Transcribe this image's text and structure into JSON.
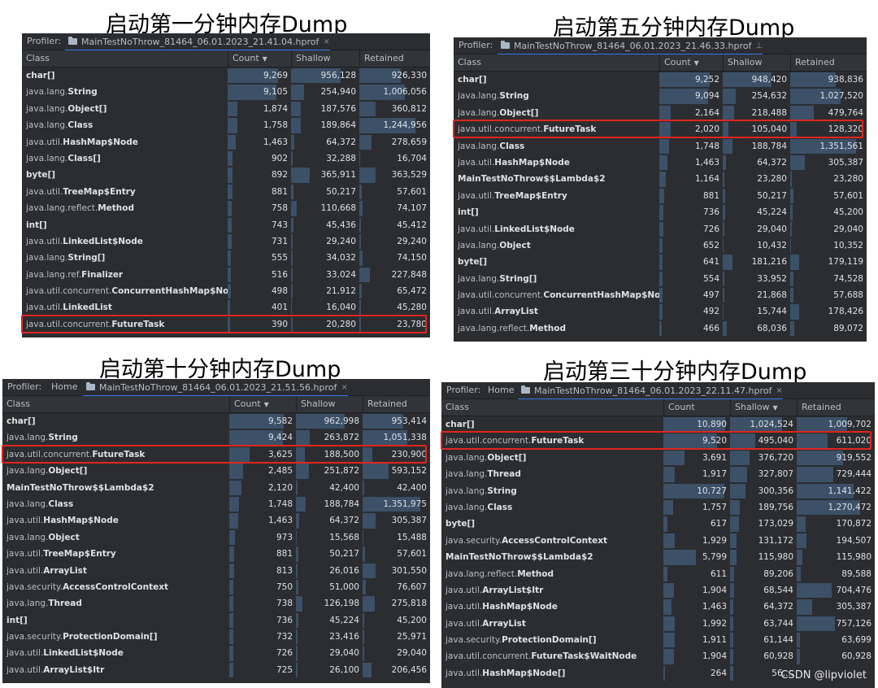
{
  "panels": [
    {
      "caption": "启动第一分钟内存Dump",
      "profiler_label": "Profiler:",
      "home_label": "",
      "tab_title": "MainTestNoThrow_81464_06.01.2023_21.41.04.hprof",
      "tab_close": "×",
      "columns": {
        "class": "Class",
        "count": "Count",
        "shallow": "Shallow",
        "retained": "Retained"
      },
      "sort_column": "count",
      "highlight_index": 15,
      "rows": [
        {
          "pre": "",
          "bold": "char[]",
          "count": "9,269",
          "shallow": "956,128",
          "retained": "926,330",
          "cf": 0.86,
          "sf": 0.78,
          "rf": 0.63
        },
        {
          "pre": "java.lang.",
          "bold": "String",
          "count": "9,105",
          "shallow": "254,940",
          "retained": "1,006,056",
          "cf": 0.84,
          "sf": 0.21,
          "rf": 0.69
        },
        {
          "pre": "java.lang.",
          "bold": "Object[]",
          "count": "1,874",
          "shallow": "187,576",
          "retained": "360,812",
          "cf": 0.17,
          "sf": 0.15,
          "rf": 0.25
        },
        {
          "pre": "java.lang.",
          "bold": "Class",
          "count": "1,758",
          "shallow": "189,864",
          "retained": "1,244,956",
          "cf": 0.16,
          "sf": 0.16,
          "rf": 0.85
        },
        {
          "pre": "java.util.",
          "bold": "HashMap$Node",
          "count": "1,463",
          "shallow": "64,372",
          "retained": "278,659",
          "cf": 0.14,
          "sf": 0.05,
          "rf": 0.19
        },
        {
          "pre": "java.lang.",
          "bold": "Class[]",
          "count": "902",
          "shallow": "32,288",
          "retained": "16,704",
          "cf": 0.08,
          "sf": 0.03,
          "rf": 0.01
        },
        {
          "pre": "",
          "bold": "byte[]",
          "count": "892",
          "shallow": "365,911",
          "retained": "363,529",
          "cf": 0.08,
          "sf": 0.3,
          "rf": 0.25
        },
        {
          "pre": "java.util.",
          "bold": "TreeMap$Entry",
          "count": "881",
          "shallow": "50,217",
          "retained": "57,601",
          "cf": 0.08,
          "sf": 0.04,
          "rf": 0.04
        },
        {
          "pre": "java.lang.reflect.",
          "bold": "Method",
          "count": "758",
          "shallow": "110,668",
          "retained": "74,107",
          "cf": 0.07,
          "sf": 0.09,
          "rf": 0.05
        },
        {
          "pre": "",
          "bold": "int[]",
          "count": "743",
          "shallow": "45,436",
          "retained": "45,412",
          "cf": 0.07,
          "sf": 0.04,
          "rf": 0.03
        },
        {
          "pre": "java.util.",
          "bold": "LinkedList$Node",
          "count": "731",
          "shallow": "29,240",
          "retained": "29,240",
          "cf": 0.07,
          "sf": 0.02,
          "rf": 0.02
        },
        {
          "pre": "java.lang.",
          "bold": "String[]",
          "count": "555",
          "shallow": "34,032",
          "retained": "74,150",
          "cf": 0.05,
          "sf": 0.03,
          "rf": 0.05
        },
        {
          "pre": "java.lang.ref.",
          "bold": "Finalizer",
          "count": "516",
          "shallow": "33,024",
          "retained": "227,848",
          "cf": 0.05,
          "sf": 0.03,
          "rf": 0.16
        },
        {
          "pre": "java.util.concurrent.",
          "bold": "ConcurrentHashMap$Node",
          "count": "498",
          "shallow": "21,912",
          "retained": "65,472",
          "cf": 0.05,
          "sf": 0.02,
          "rf": 0.04
        },
        {
          "pre": "java.util.",
          "bold": "LinkedList",
          "count": "401",
          "shallow": "16,040",
          "retained": "45,280",
          "cf": 0.04,
          "sf": 0.01,
          "rf": 0.03
        },
        {
          "pre": "java.util.concurrent.",
          "bold": "FutureTask",
          "count": "390",
          "shallow": "20,280",
          "retained": "23,780",
          "cf": 0.04,
          "sf": 0.02,
          "rf": 0.02
        }
      ]
    },
    {
      "caption": "启动第五分钟内存Dump",
      "profiler_label": "Profiler:",
      "home_label": "",
      "tab_title": "MainTestNoThrow_81464_06.01.2023_21.46.33.hprof",
      "tab_close": "",
      "columns": {
        "class": "Class",
        "count": "Count",
        "shallow": "Shallow",
        "retained": "Retained"
      },
      "sort_column": "count",
      "highlight_index": 3,
      "rows": [
        {
          "pre": "",
          "bold": "char[]",
          "count": "9,252",
          "shallow": "948,420",
          "retained": "938,836",
          "cf": 0.86,
          "sf": 0.78,
          "rf": 0.64
        },
        {
          "pre": "java.lang.",
          "bold": "String",
          "count": "9,094",
          "shallow": "254,632",
          "retained": "1,027,520",
          "cf": 0.84,
          "sf": 0.21,
          "rf": 0.7
        },
        {
          "pre": "java.lang.",
          "bold": "Object[]",
          "count": "2,164",
          "shallow": "218,488",
          "retained": "479,764",
          "cf": 0.2,
          "sf": 0.18,
          "rf": 0.33
        },
        {
          "pre": "java.util.concurrent.",
          "bold": "FutureTask",
          "count": "2,020",
          "shallow": "105,040",
          "retained": "128,320",
          "cf": 0.19,
          "sf": 0.09,
          "rf": 0.09
        },
        {
          "pre": "java.lang.",
          "bold": "Class",
          "count": "1,748",
          "shallow": "188,784",
          "retained": "1,351,561",
          "cf": 0.16,
          "sf": 0.16,
          "rf": 0.92
        },
        {
          "pre": "java.util.",
          "bold": "HashMap$Node",
          "count": "1,463",
          "shallow": "64,372",
          "retained": "305,387",
          "cf": 0.14,
          "sf": 0.05,
          "rf": 0.21
        },
        {
          "pre": "",
          "bold": "MainTestNoThrow$$Lambda$2",
          "count": "1,164",
          "shallow": "23,280",
          "retained": "23,280",
          "cf": 0.11,
          "sf": 0.02,
          "rf": 0.02
        },
        {
          "pre": "java.util.",
          "bold": "TreeMap$Entry",
          "count": "881",
          "shallow": "50,217",
          "retained": "57,601",
          "cf": 0.08,
          "sf": 0.04,
          "rf": 0.04
        },
        {
          "pre": "",
          "bold": "int[]",
          "count": "736",
          "shallow": "45,224",
          "retained": "45,200",
          "cf": 0.07,
          "sf": 0.04,
          "rf": 0.03
        },
        {
          "pre": "java.util.",
          "bold": "LinkedList$Node",
          "count": "726",
          "shallow": "29,040",
          "retained": "29,040",
          "cf": 0.07,
          "sf": 0.02,
          "rf": 0.02
        },
        {
          "pre": "java.lang.",
          "bold": "Object",
          "count": "652",
          "shallow": "10,432",
          "retained": "10,352",
          "cf": 0.06,
          "sf": 0.01,
          "rf": 0.01
        },
        {
          "pre": "",
          "bold": "byte[]",
          "count": "641",
          "shallow": "181,216",
          "retained": "179,119",
          "cf": 0.06,
          "sf": 0.15,
          "rf": 0.12
        },
        {
          "pre": "java.lang.",
          "bold": "String[]",
          "count": "554",
          "shallow": "33,952",
          "retained": "74,528",
          "cf": 0.05,
          "sf": 0.03,
          "rf": 0.05
        },
        {
          "pre": "java.util.concurrent.",
          "bold": "ConcurrentHashMap$Node",
          "count": "497",
          "shallow": "21,868",
          "retained": "57,688",
          "cf": 0.05,
          "sf": 0.02,
          "rf": 0.04
        },
        {
          "pre": "java.util.",
          "bold": "ArrayList",
          "count": "492",
          "shallow": "15,744",
          "retained": "178,426",
          "cf": 0.05,
          "sf": 0.01,
          "rf": 0.12
        },
        {
          "pre": "java.lang.reflect.",
          "bold": "Method",
          "count": "466",
          "shallow": "68,036",
          "retained": "89,072",
          "cf": 0.04,
          "sf": 0.06,
          "rf": 0.06
        }
      ]
    },
    {
      "caption": "启动第十分钟内存Dump",
      "profiler_label": "Profiler:",
      "home_label": "Home",
      "tab_title": "MainTestNoThrow_81464_06.01.2023_21.51.56.hprof",
      "tab_close": "×",
      "columns": {
        "class": "Class",
        "count": "Count",
        "shallow": "Shallow",
        "retained": "Retained"
      },
      "sort_column": "count",
      "highlight_index": 2,
      "rows": [
        {
          "pre": "",
          "bold": "char[]",
          "count": "9,582",
          "shallow": "962,998",
          "retained": "953,414",
          "cf": 0.88,
          "sf": 0.79,
          "rf": 0.65
        },
        {
          "pre": "java.lang.",
          "bold": "String",
          "count": "9,424",
          "shallow": "263,872",
          "retained": "1,051,338",
          "cf": 0.87,
          "sf": 0.22,
          "rf": 0.72
        },
        {
          "pre": "java.util.concurrent.",
          "bold": "FutureTask",
          "count": "3,625",
          "shallow": "188,500",
          "retained": "230,900",
          "cf": 0.33,
          "sf": 0.15,
          "rf": 0.16
        },
        {
          "pre": "java.lang.",
          "bold": "Object[]",
          "count": "2,485",
          "shallow": "251,872",
          "retained": "593,152",
          "cf": 0.23,
          "sf": 0.21,
          "rf": 0.41
        },
        {
          "pre": "",
          "bold": "MainTestNoThrow$$Lambda$2",
          "count": "2,120",
          "shallow": "42,400",
          "retained": "42,400",
          "cf": 0.2,
          "sf": 0.03,
          "rf": 0.03
        },
        {
          "pre": "java.lang.",
          "bold": "Class",
          "count": "1,748",
          "shallow": "188,784",
          "retained": "1,351,975",
          "cf": 0.16,
          "sf": 0.16,
          "rf": 0.92
        },
        {
          "pre": "java.util.",
          "bold": "HashMap$Node",
          "count": "1,463",
          "shallow": "64,372",
          "retained": "305,387",
          "cf": 0.14,
          "sf": 0.05,
          "rf": 0.21
        },
        {
          "pre": "java.lang.",
          "bold": "Object",
          "count": "973",
          "shallow": "15,568",
          "retained": "15,488",
          "cf": 0.09,
          "sf": 0.01,
          "rf": 0.01
        },
        {
          "pre": "java.util.",
          "bold": "TreeMap$Entry",
          "count": "881",
          "shallow": "50,217",
          "retained": "57,601",
          "cf": 0.08,
          "sf": 0.04,
          "rf": 0.04
        },
        {
          "pre": "java.util.",
          "bold": "ArrayList",
          "count": "813",
          "shallow": "26,016",
          "retained": "301,550",
          "cf": 0.08,
          "sf": 0.02,
          "rf": 0.21
        },
        {
          "pre": "java.security.",
          "bold": "AccessControlContext",
          "count": "750",
          "shallow": "51,000",
          "retained": "76,607",
          "cf": 0.07,
          "sf": 0.04,
          "rf": 0.05
        },
        {
          "pre": "java.lang.",
          "bold": "Thread",
          "count": "738",
          "shallow": "126,198",
          "retained": "275,818",
          "cf": 0.07,
          "sf": 0.1,
          "rf": 0.19
        },
        {
          "pre": "",
          "bold": "int[]",
          "count": "736",
          "shallow": "45,224",
          "retained": "45,200",
          "cf": 0.07,
          "sf": 0.04,
          "rf": 0.03
        },
        {
          "pre": "java.security.",
          "bold": "ProtectionDomain[]",
          "count": "732",
          "shallow": "23,416",
          "retained": "25,971",
          "cf": 0.07,
          "sf": 0.02,
          "rf": 0.02
        },
        {
          "pre": "java.util.",
          "bold": "LinkedList$Node",
          "count": "726",
          "shallow": "29,040",
          "retained": "29,040",
          "cf": 0.07,
          "sf": 0.02,
          "rf": 0.02
        },
        {
          "pre": "java.util.",
          "bold": "ArrayList$Itr",
          "count": "725",
          "shallow": "26,100",
          "retained": "206,456",
          "cf": 0.07,
          "sf": 0.02,
          "rf": 0.14
        }
      ]
    },
    {
      "caption": "启动第三十分钟内存Dump",
      "profiler_label": "Profiler:",
      "home_label": "Home",
      "tab_title": "MainTestNoThrow_81464_06.01.2023_22.11.47.hprof",
      "tab_close": "×",
      "columns": {
        "class": "Class",
        "count": "Count",
        "shallow": "Shallow",
        "retained": "Retained"
      },
      "sort_column": "shallow",
      "highlight_index": 1,
      "rows": [
        {
          "pre": "",
          "bold": "char[]",
          "count": "10,890",
          "shallow": "1,024,524",
          "retained": "1,009,702",
          "cf": 1.0,
          "sf": 0.84,
          "rf": 0.69
        },
        {
          "pre": "java.util.concurrent.",
          "bold": "FutureTask",
          "count": "9,520",
          "shallow": "495,040",
          "retained": "611,020",
          "cf": 0.87,
          "sf": 0.41,
          "rf": 0.42
        },
        {
          "pre": "java.lang.",
          "bold": "Object[]",
          "count": "3,691",
          "shallow": "376,720",
          "retained": "919,552",
          "cf": 0.34,
          "sf": 0.31,
          "rf": 0.63
        },
        {
          "pre": "java.lang.",
          "bold": "Thread",
          "count": "1,917",
          "shallow": "327,807",
          "retained": "729,444",
          "cf": 0.18,
          "sf": 0.27,
          "rf": 0.5
        },
        {
          "pre": "java.lang.",
          "bold": "String",
          "count": "10,727",
          "shallow": "300,356",
          "retained": "1,141,422",
          "cf": 0.99,
          "sf": 0.25,
          "rf": 0.78
        },
        {
          "pre": "java.lang.",
          "bold": "Class",
          "count": "1,757",
          "shallow": "189,756",
          "retained": "1,270,472",
          "cf": 0.16,
          "sf": 0.16,
          "rf": 0.87
        },
        {
          "pre": "",
          "bold": "byte[]",
          "count": "617",
          "shallow": "173,029",
          "retained": "170,872",
          "cf": 0.06,
          "sf": 0.14,
          "rf": 0.12
        },
        {
          "pre": "java.security.",
          "bold": "AccessControlContext",
          "count": "1,929",
          "shallow": "131,172",
          "retained": "194,507",
          "cf": 0.18,
          "sf": 0.11,
          "rf": 0.13
        },
        {
          "pre": "",
          "bold": "MainTestNoThrow$$Lambda$2",
          "count": "5,799",
          "shallow": "115,980",
          "retained": "115,980",
          "cf": 0.53,
          "sf": 0.1,
          "rf": 0.08
        },
        {
          "pre": "java.lang.reflect.",
          "bold": "Method",
          "count": "611",
          "shallow": "89,206",
          "retained": "89,588",
          "cf": 0.06,
          "sf": 0.07,
          "rf": 0.06
        },
        {
          "pre": "java.util.",
          "bold": "ArrayList$Itr",
          "count": "1,904",
          "shallow": "68,544",
          "retained": "704,476",
          "cf": 0.17,
          "sf": 0.06,
          "rf": 0.48
        },
        {
          "pre": "java.util.",
          "bold": "HashMap$Node",
          "count": "1,463",
          "shallow": "64,372",
          "retained": "305,387",
          "cf": 0.13,
          "sf": 0.05,
          "rf": 0.21
        },
        {
          "pre": "java.util.",
          "bold": "ArrayList",
          "count": "1,992",
          "shallow": "63,744",
          "retained": "757,126",
          "cf": 0.18,
          "sf": 0.05,
          "rf": 0.52
        },
        {
          "pre": "java.security.",
          "bold": "ProtectionDomain[]",
          "count": "1,911",
          "shallow": "61,144",
          "retained": "63,699",
          "cf": 0.18,
          "sf": 0.05,
          "rf": 0.04
        },
        {
          "pre": "java.util.concurrent.",
          "bold": "FutureTask$WaitNode",
          "count": "1,904",
          "shallow": "60,928",
          "retained": "60,928",
          "cf": 0.17,
          "sf": 0.05,
          "rf": 0.04
        },
        {
          "pre": "java.util.",
          "bold": "HashMap$Node[]",
          "count": "264",
          "shallow": "56,...",
          "retained": "",
          "cf": 0.02,
          "sf": 0.05,
          "rf": 0.0
        }
      ]
    }
  ],
  "watermark": "CSDN @lipviolet",
  "colors": {
    "panel_bg": "#2b2d30",
    "header_bg": "#313438",
    "bar": "#3c5068",
    "highlight": "#e0261e",
    "tab_underline": "#3574f0"
  }
}
